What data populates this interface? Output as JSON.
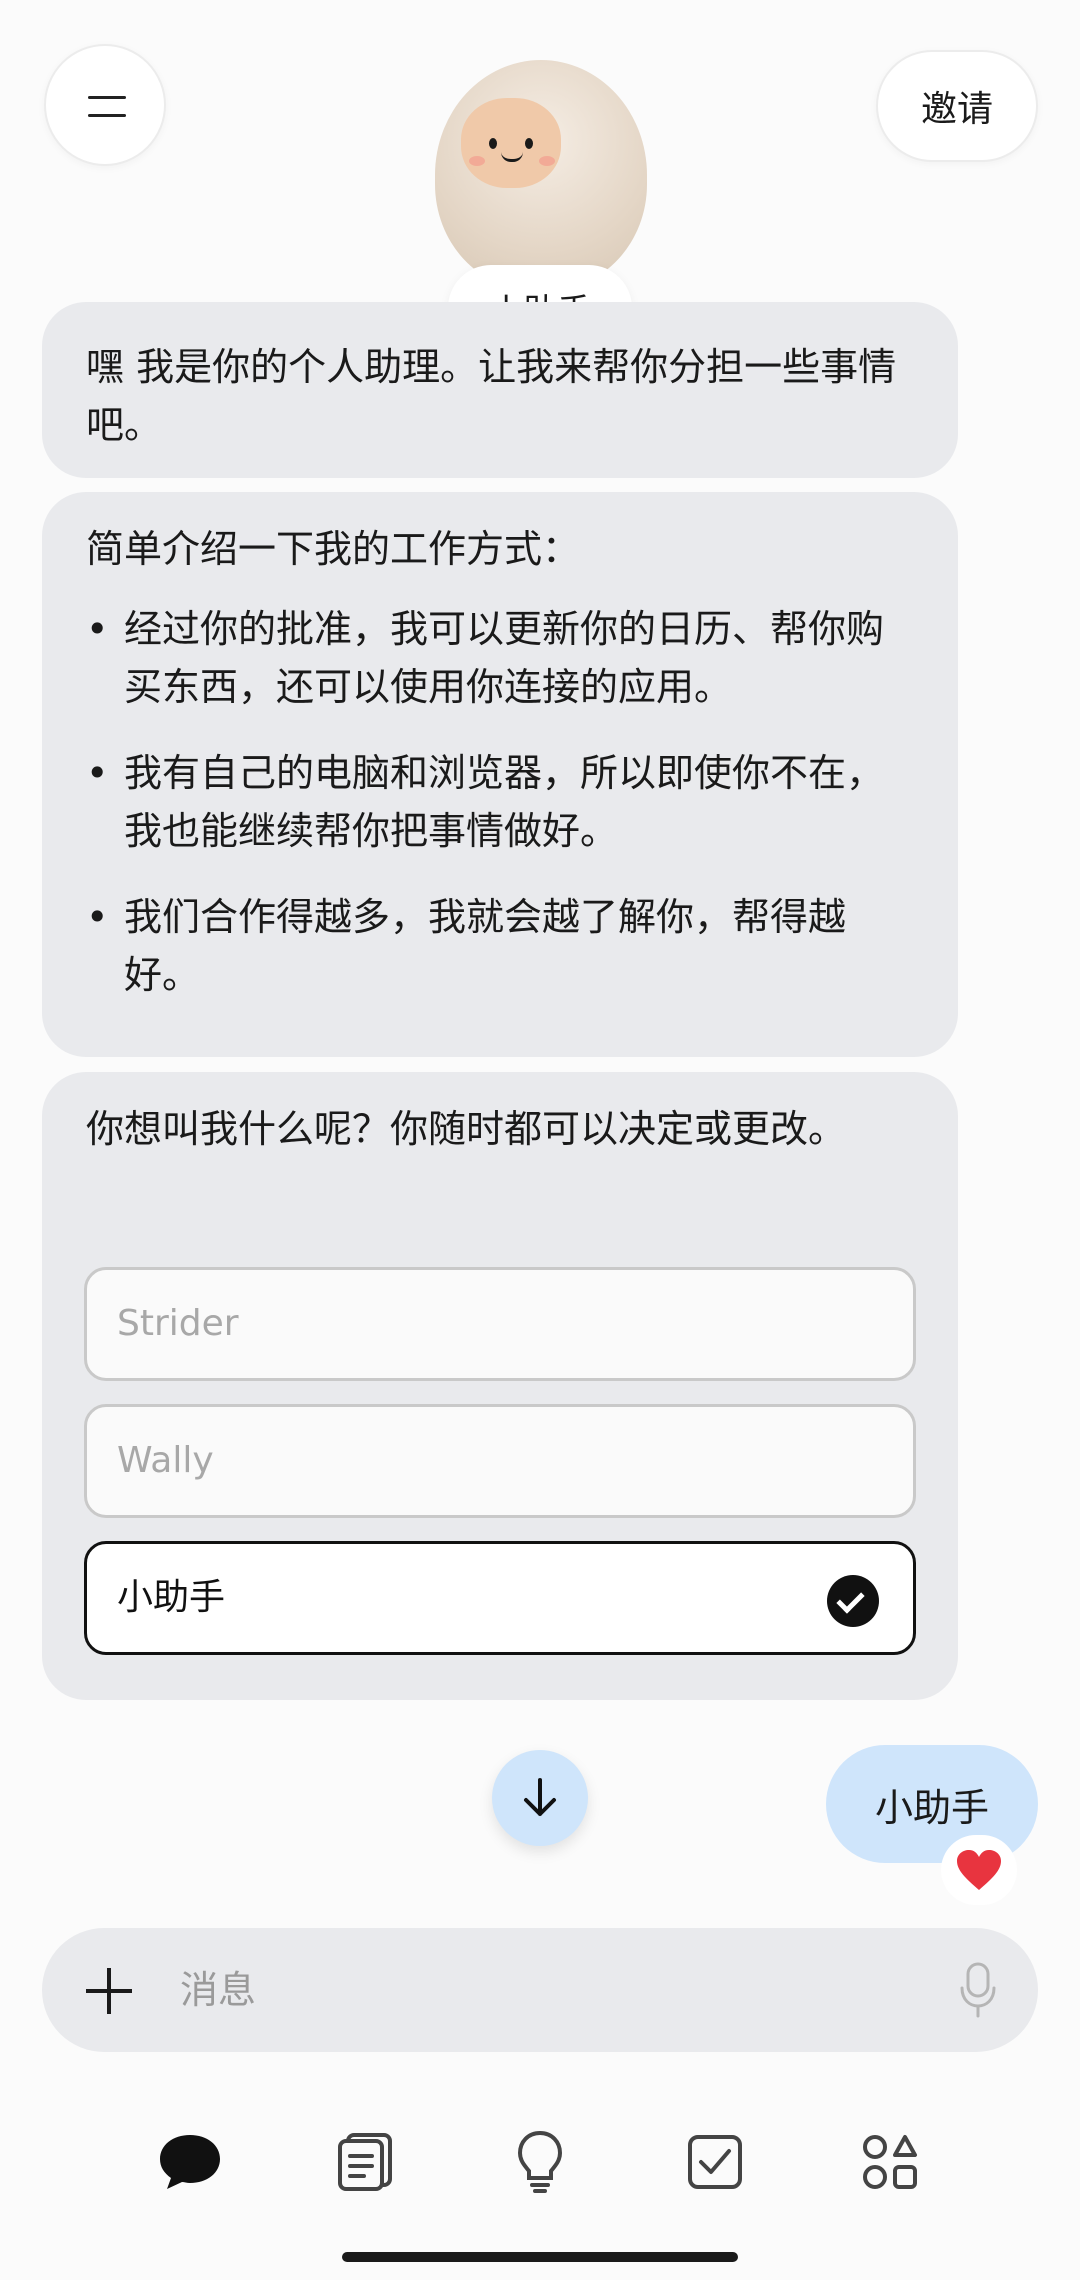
{
  "header": {
    "menu_icon": "menu-icon",
    "invite_label": "邀请",
    "assistant_name": "小助手"
  },
  "messages": {
    "greeting": "嘿        我是你的个人助理。让我来帮你分担一些事情吧。",
    "intro_title": "简单介绍一下我的工作方式：",
    "bullets": [
      "经过你的批准，我可以更新你的日历、帮你购买东西，还可以使用你连接的应用。",
      "我有自己的电脑和浏览器，所以即使你不在，我也能继续帮你把事情做好。",
      "我们合作得越多，我就会越了解你，帮得越好。"
    ],
    "name_question": "你想叫我什么呢？你随时都可以决定或更改。",
    "name_options": [
      "Strider",
      "Wally",
      "小助手"
    ],
    "selected_option": "小助手",
    "user_reply": "小助手",
    "reaction": "❤️"
  },
  "composer": {
    "placeholder": "消息"
  },
  "tabbar": {
    "items": [
      "chat-icon",
      "notes-icon",
      "lightbulb-icon",
      "checkbox-icon",
      "apps-icon"
    ]
  },
  "colors": {
    "assistant_bubble": "#e9eaed",
    "user_bubble": "#cfe5fb",
    "heart": "#e8343f"
  }
}
